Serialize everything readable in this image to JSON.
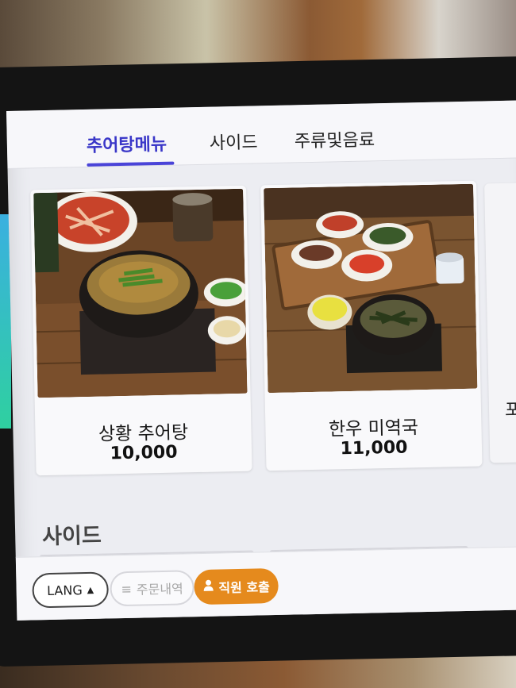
{
  "tabs": [
    {
      "label": "추어탕메뉴",
      "active": true
    },
    {
      "label": "사이드",
      "active": false
    },
    {
      "label": "주류및음료",
      "active": false
    }
  ],
  "menu_items": [
    {
      "name": "상황 추어탕",
      "price": "10,000"
    },
    {
      "name": "한우 미역국",
      "price": "11,000"
    },
    {
      "name": "포장"
    }
  ],
  "section": {
    "title": "사이드"
  },
  "bottom_bar": {
    "lang_label": "LANG",
    "lang_caret": "▲",
    "orders_label": "주문내역",
    "orders_icon": "≡",
    "call_label": "직원 호출",
    "call_icon": "person-icon"
  },
  "colors": {
    "accent": "#3a37c8",
    "call_button": "#e58a1d"
  }
}
